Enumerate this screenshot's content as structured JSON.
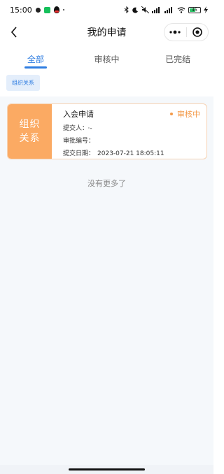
{
  "status_bar": {
    "time": "15:00",
    "battery_level": "45",
    "icons": [
      "dot-icon",
      "wechat-icon",
      "qq-icon",
      "bluetooth-icon",
      "moon-icon",
      "mute-icon",
      "signal-icon",
      "wifi-icon",
      "battery-icon",
      "charging-icon"
    ]
  },
  "nav": {
    "title": "我的申请",
    "back_icon": "chevron-left-icon",
    "menu_icon": "more-dots-icon",
    "close_icon": "target-circle-icon"
  },
  "tabs": [
    {
      "label": "全部",
      "active": true
    },
    {
      "label": "审核中",
      "active": false
    },
    {
      "label": "已完结",
      "active": false
    }
  ],
  "filter": {
    "chip_label": "组织关系"
  },
  "applications": [
    {
      "tag_line1": "组织",
      "tag_line2": "关系",
      "title": "入会申请",
      "status": "审核中",
      "submitter_label": "提交人：",
      "submitter_value": "·-",
      "approval_no_label": "审批编号：",
      "approval_no_value": "",
      "date_label": "提交日期：",
      "date_value": "2023-07-21 18:05:11"
    }
  ],
  "no_more_text": "没有更多了",
  "colors": {
    "accent_blue": "#2f7de1",
    "tag_orange": "#fbaa63",
    "status_orange": "#f39a4a"
  }
}
